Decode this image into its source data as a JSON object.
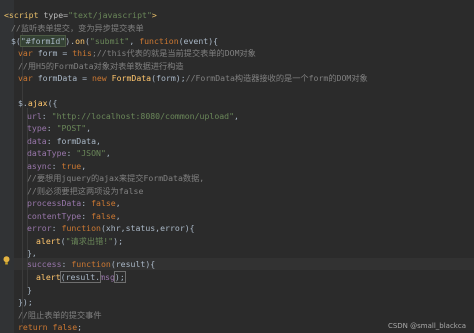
{
  "code": {
    "l1_open": "<script",
    "l1_attr": " type=",
    "l1_val": "\"text/javascript\"",
    "l1_close": ">",
    "l2_comment": "//监听表单提交，变为异步提交表单",
    "l3_a": "$(",
    "l3_sel": "\"#formId\"",
    "l3_b": ").",
    "l3_fn": "on",
    "l3_c": "(",
    "l3_str": "\"submit\"",
    "l3_d": ", ",
    "l3_kw": "function",
    "l3_e": "(event){",
    "l4_kw": "var",
    "l4_a": " form = ",
    "l4_this": "this",
    "l4_comment": ";//this代表的就是当前提交表单的DOM对象",
    "l5_comment": "//用H5的FormData对象对表单数据进行构造",
    "l6_kw": "var",
    "l6_a": " formData = ",
    "l6_new": "new",
    "l6_fn": " FormData",
    "l6_b": "(form);",
    "l6_comment": "//FormData构造器接收的是一个form的DOM对象",
    "l8_a": "$.",
    "l8_fn": "ajax",
    "l8_b": "({",
    "l9_prop": "url",
    "l9_a": ": ",
    "l9_str": "\"http://localhost:8080/common/upload\"",
    "l9_b": ",",
    "l10_prop": "type",
    "l10_a": ": ",
    "l10_str": "\"POST\"",
    "l10_b": ",",
    "l11_prop": "data",
    "l11_a": ": formData,",
    "l12_prop": "dataType",
    "l12_a": ": ",
    "l12_str": "\"JSON\"",
    "l12_b": ",",
    "l13_prop": "async",
    "l13_a": ": ",
    "l13_kw": "true",
    "l13_b": ",",
    "l14_comment": "//要想用jquery的ajax来提交FormData数据,",
    "l15_comment": "//则必须要把这两项设为false",
    "l16_prop": "processData",
    "l16_a": ": ",
    "l16_kw": "false",
    "l16_b": ",",
    "l17_prop": "contentType",
    "l17_a": ": ",
    "l17_kw": "false",
    "l17_b": ",",
    "l18_prop": "error",
    "l18_a": ": ",
    "l18_kw": "function",
    "l18_b": "(xhr,status,error){",
    "l19_fn": "alert",
    "l19_a": "(",
    "l19_str": "\"请求出错!\"",
    "l19_b": ");",
    "l20": "},",
    "l21_prop": "success",
    "l21_a": ": ",
    "l21_kw": "function",
    "l21_b": "(result){",
    "l22_fn": "alert",
    "l22_a": "(result.",
    "l22_prop": "msg",
    "l22_b": ");",
    "l23": "}",
    "l24": "});",
    "l26_comment": "//阻止表单的提交事件",
    "l27_kw": "return",
    "l27_a": " ",
    "l27_kw2": "false",
    "l27_b": ";"
  },
  "watermark": "CSDN @small_blackca"
}
